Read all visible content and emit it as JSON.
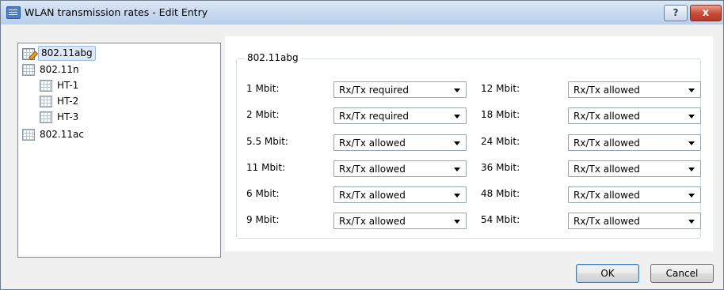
{
  "window": {
    "title": "WLAN transmission rates - Edit Entry",
    "help_label": "?",
    "close_label": "x"
  },
  "tree": {
    "items": [
      {
        "label": "802.11abg",
        "selected": true
      },
      {
        "label": "802.11n"
      },
      {
        "label": "HT-1"
      },
      {
        "label": "HT-2"
      },
      {
        "label": "HT-3"
      },
      {
        "label": "802.11ac"
      }
    ]
  },
  "group": {
    "title": "802.11abg",
    "left": [
      {
        "label": "1 Mbit:",
        "value": "Rx/Tx required"
      },
      {
        "label": "2 Mbit:",
        "value": "Rx/Tx required"
      },
      {
        "label": "5.5 Mbit:",
        "value": "Rx/Tx allowed"
      },
      {
        "label": "11 Mbit:",
        "value": "Rx/Tx allowed"
      },
      {
        "label": "6 Mbit:",
        "value": "Rx/Tx allowed"
      },
      {
        "label": "9 Mbit:",
        "value": "Rx/Tx allowed"
      }
    ],
    "right": [
      {
        "label": "12 Mbit:",
        "value": "Rx/Tx allowed"
      },
      {
        "label": "18 Mbit:",
        "value": "Rx/Tx allowed"
      },
      {
        "label": "24 Mbit:",
        "value": "Rx/Tx allowed"
      },
      {
        "label": "36 Mbit:",
        "value": "Rx/Tx allowed"
      },
      {
        "label": "48 Mbit:",
        "value": "Rx/Tx allowed"
      },
      {
        "label": "54 Mbit:",
        "value": "Rx/Tx allowed"
      }
    ]
  },
  "buttons": {
    "ok": "OK",
    "cancel": "Cancel"
  }
}
